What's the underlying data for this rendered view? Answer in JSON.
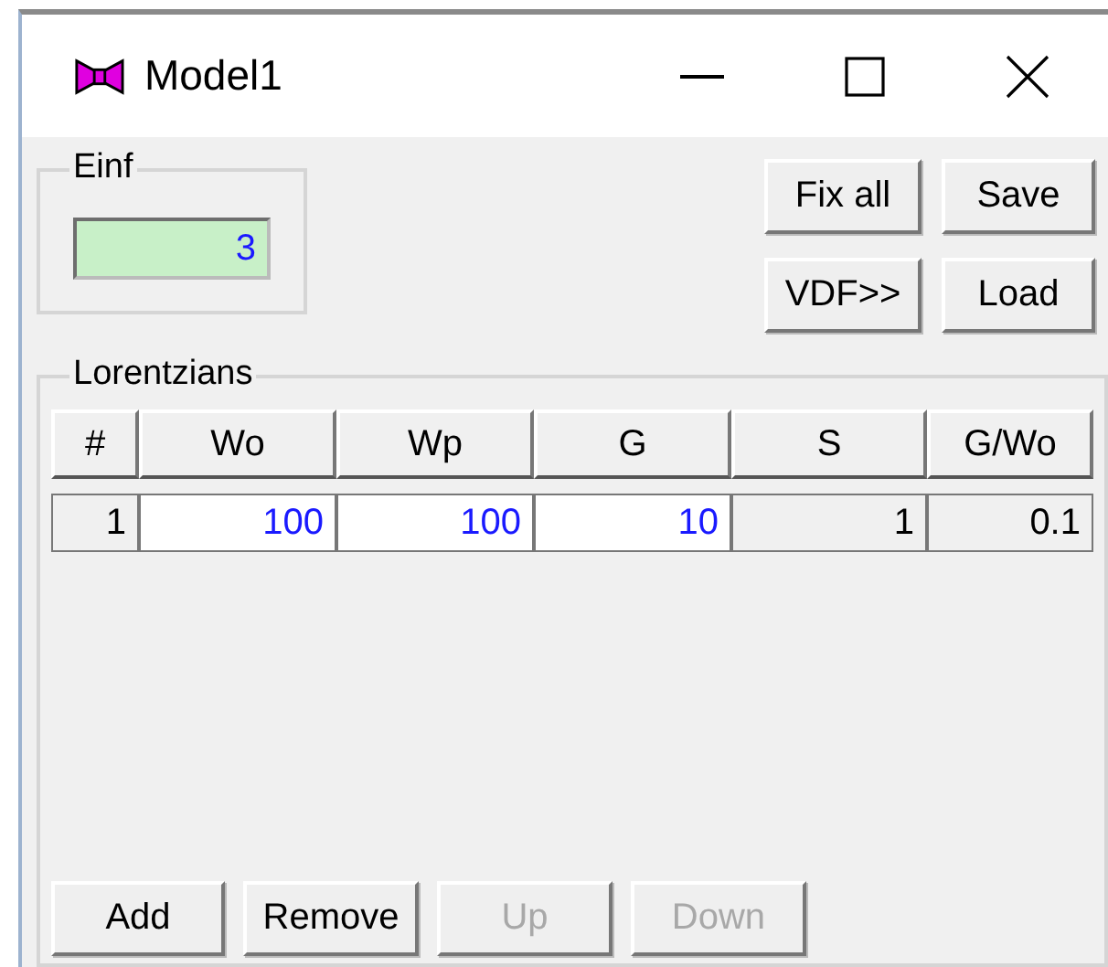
{
  "window": {
    "title": "Model1"
  },
  "einf": {
    "label": "Einf",
    "value": "3"
  },
  "buttons": [
    {
      "label": "Fix all"
    },
    {
      "label": "Save"
    },
    {
      "label": "VDF>>"
    },
    {
      "label": "Load"
    }
  ],
  "lorentzians": {
    "label": "Lorentzians",
    "columns": [
      "#",
      "Wo",
      "Wp",
      "G",
      "S",
      "G/Wo"
    ],
    "rows": [
      [
        {
          "text": "1",
          "kind": "index"
        },
        {
          "text": "100",
          "kind": "input"
        },
        {
          "text": "100",
          "kind": "input"
        },
        {
          "text": "10",
          "kind": "input"
        },
        {
          "text": "1",
          "kind": "value"
        },
        {
          "text": "0.1",
          "kind": "value"
        }
      ]
    ],
    "actions": [
      {
        "label": "Add",
        "disabled": false
      },
      {
        "label": "Remove",
        "disabled": false
      },
      {
        "label": "Up",
        "disabled": true
      },
      {
        "label": "Down",
        "disabled": true
      }
    ]
  }
}
